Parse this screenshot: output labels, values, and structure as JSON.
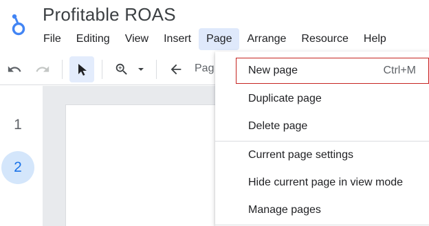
{
  "header": {
    "title": "Profitable ROAS",
    "logo_icon": "looker-studio-logo-icon"
  },
  "menubar": {
    "items": [
      {
        "label": "File"
      },
      {
        "label": "Editing"
      },
      {
        "label": "View"
      },
      {
        "label": "Insert"
      },
      {
        "label": "Page",
        "active": true
      },
      {
        "label": "Arrange"
      },
      {
        "label": "Resource"
      },
      {
        "label": "Help"
      }
    ]
  },
  "toolbar": {
    "undo_icon": "undo-icon",
    "redo_icon": "redo-icon",
    "select_icon": "cursor-arrow-icon",
    "zoom_icon": "zoom-in-icon",
    "zoom_caret_icon": "caret-down-icon",
    "back_icon": "arrow-left-icon",
    "page_nav_label": "Pag"
  },
  "pages_rail": {
    "pages": [
      "1",
      "2"
    ],
    "current": "2"
  },
  "page_menu": {
    "items": [
      {
        "label": "New page",
        "shortcut": "Ctrl+M",
        "highlighted": true
      },
      {
        "label": "Duplicate page"
      },
      {
        "label": "Delete page"
      },
      {
        "label": "Current page settings"
      },
      {
        "label": "Hide current page in view mode"
      },
      {
        "label": "Manage pages"
      }
    ]
  },
  "colors": {
    "accent": "#1a73e8",
    "menu_active_bg": "#dfe9fb",
    "highlight_border": "#c5221f"
  }
}
